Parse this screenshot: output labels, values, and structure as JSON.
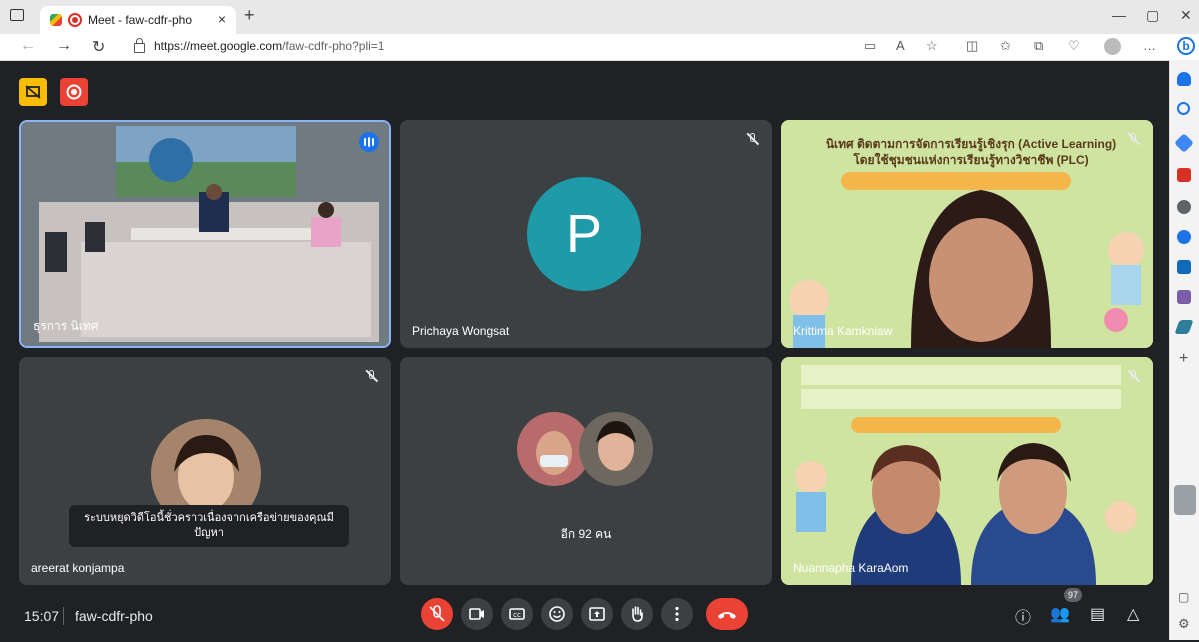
{
  "browser": {
    "tab_title": "Meet - faw-cdfr-pho",
    "url_domain": "https://meet.google.com",
    "url_path": "/faw-cdfr-pho?pli=1"
  },
  "tiles": [
    {
      "name": "ธุรการ นิเทศ"
    },
    {
      "name": "Prichaya Wongsat",
      "avatar_letter": "P"
    },
    {
      "name": "Krittima Kamkniaw",
      "slide_title": "นิเทศ ติดตามการจัดการเรียนรู้เชิงรุก (Active Learning)",
      "slide_subtitle": "โดยใช้ชุมชนแห่งการเรียนรู้ทางวิชาชีพ (PLC)"
    },
    {
      "name": "areerat konjampa",
      "caption": "ระบบหยุดวิดีโอนี้ชั่วคราวเนื่องจากเครือข่ายของคุณมีปัญหา"
    },
    {
      "name": "",
      "more_label": "อีก 92 คน"
    },
    {
      "name": "Nuannapha KaraAom"
    }
  ],
  "bottom": {
    "time": "15:07",
    "meeting_code": "faw-cdfr-pho",
    "participants_badge": "97"
  },
  "colors": {
    "meet_bg": "#202124",
    "tile_bg": "#3c4043",
    "accent_red": "#ea4335",
    "accent_blue": "#1a73e8"
  }
}
